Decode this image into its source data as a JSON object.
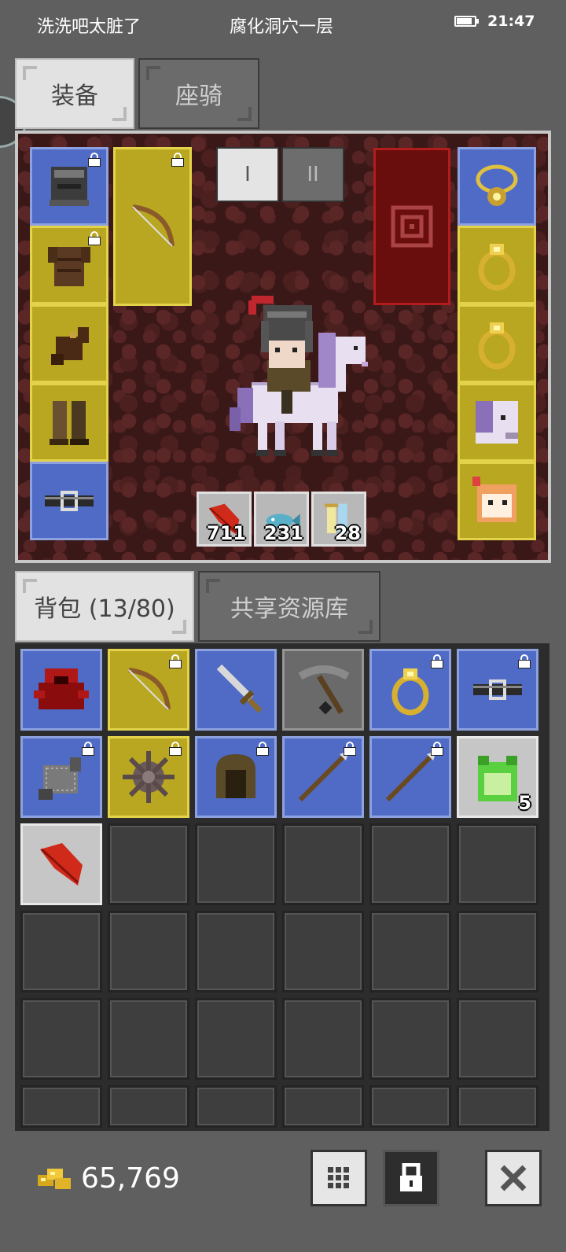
{
  "status": {
    "left_text": "洗洗吧太脏了",
    "center_text": "腐化洞穴一层",
    "time": "21:47",
    "battery_level": 0.85
  },
  "top_tabs": [
    {
      "label": "装备",
      "active": true
    },
    {
      "label": "座骑",
      "active": false
    }
  ],
  "page_buttons": [
    {
      "label": "I",
      "active": true
    },
    {
      "label": "II",
      "active": false
    }
  ],
  "equipment": {
    "left_slots": [
      {
        "icon": "helmet-icon",
        "color": "blue",
        "locked": true
      },
      {
        "icon": "leather-armor-icon",
        "color": "gold",
        "locked": true
      },
      {
        "icon": "glove-icon",
        "color": "gold",
        "locked": false
      },
      {
        "icon": "boots-icon",
        "color": "gold",
        "locked": false
      },
      {
        "icon": "belt-icon",
        "color": "blue",
        "locked": false
      }
    ],
    "weapon_slot": {
      "icon": "bow-icon",
      "color": "gold",
      "locked": true
    },
    "right_slots": [
      {
        "icon": "amulet-icon",
        "color": "blue",
        "locked": false
      },
      {
        "icon": "ring-icon",
        "color": "gold",
        "locked": false
      },
      {
        "icon": "ring-icon",
        "color": "gold",
        "locked": false
      },
      {
        "icon": "horse-portrait-icon",
        "color": "gold",
        "locked": false
      },
      {
        "icon": "pet-portrait-icon",
        "color": "gold",
        "locked": false
      }
    ],
    "consumables": [
      {
        "icon": "red-feather-icon",
        "count": "711"
      },
      {
        "icon": "fish-icon",
        "count": "231"
      },
      {
        "icon": "scroll-icon",
        "count": "28"
      }
    ]
  },
  "bottom_tabs": [
    {
      "label": "背包 (13/80)",
      "active": true
    },
    {
      "label": "共享资源库",
      "active": false
    }
  ],
  "bag": {
    "items": [
      {
        "icon": "red-cloak-icon",
        "color": "blue",
        "locked": false,
        "count": ""
      },
      {
        "icon": "bow-icon",
        "color": "gold",
        "locked": true,
        "count": ""
      },
      {
        "icon": "sword-icon",
        "color": "blue",
        "locked": false,
        "count": ""
      },
      {
        "icon": "pickaxe-icon",
        "color": "grey",
        "locked": false,
        "count": ""
      },
      {
        "icon": "ring-icon",
        "color": "blue",
        "locked": true,
        "count": ""
      },
      {
        "icon": "belt-icon",
        "color": "blue",
        "locked": true,
        "count": ""
      },
      {
        "icon": "chain-glove-icon",
        "color": "blue",
        "locked": true,
        "count": ""
      },
      {
        "icon": "spiked-ball-icon",
        "color": "gold",
        "locked": true,
        "count": ""
      },
      {
        "icon": "hood-icon",
        "color": "blue",
        "locked": true,
        "count": ""
      },
      {
        "icon": "spear-icon",
        "color": "blue",
        "locked": true,
        "count": ""
      },
      {
        "icon": "spear-icon",
        "color": "blue",
        "locked": true,
        "count": ""
      },
      {
        "icon": "frog-icon",
        "color": "light",
        "locked": false,
        "count": "5"
      },
      {
        "icon": "red-feather-icon",
        "color": "light",
        "locked": false,
        "count": ""
      }
    ]
  },
  "gold": {
    "amount": "65,769"
  },
  "toolbar": [
    {
      "name": "grid-sort-button",
      "icon": "grid-icon"
    },
    {
      "name": "lock-mode-button",
      "icon": "lock-icon"
    },
    {
      "name": "close-button",
      "icon": "close-icon"
    }
  ]
}
